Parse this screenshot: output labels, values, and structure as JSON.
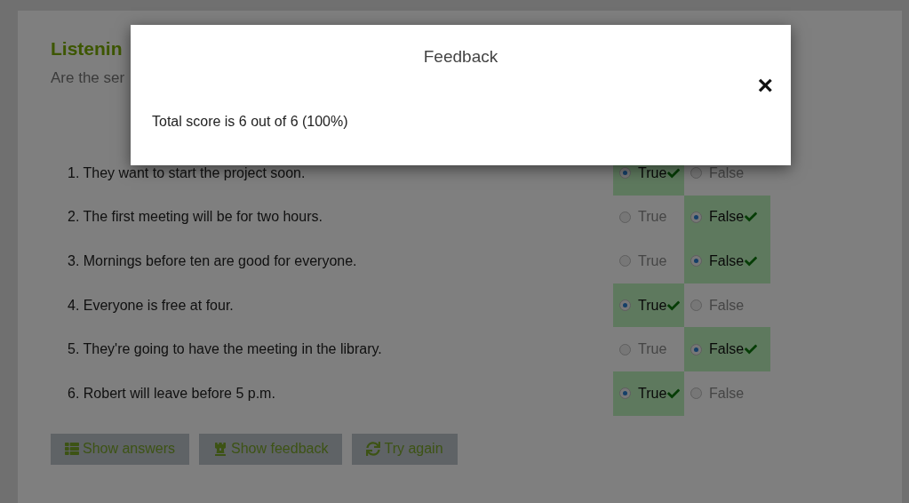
{
  "page": {
    "title": "Listenin",
    "instructions": "Are the ser"
  },
  "modal": {
    "title": "Feedback",
    "close": "×",
    "message": "Total score is 6 out of 6 (100%)"
  },
  "questions": [
    {
      "text": "1. They want to start the project soon.",
      "options": [
        {
          "label": "True",
          "selected": true,
          "correct": true
        },
        {
          "label": "False",
          "selected": false,
          "correct": false
        }
      ]
    },
    {
      "text": "2. The first meeting will be for two hours.",
      "options": [
        {
          "label": "True",
          "selected": false,
          "correct": false
        },
        {
          "label": "False",
          "selected": true,
          "correct": true
        }
      ]
    },
    {
      "text": "3. Mornings before ten are good for everyone.",
      "options": [
        {
          "label": "True",
          "selected": false,
          "correct": false
        },
        {
          "label": "False",
          "selected": true,
          "correct": true
        }
      ]
    },
    {
      "text": "4. Everyone is free at four.",
      "options": [
        {
          "label": "True",
          "selected": true,
          "correct": true
        },
        {
          "label": "False",
          "selected": false,
          "correct": false
        }
      ]
    },
    {
      "text": "5. They're going to have the meeting in the library.",
      "options": [
        {
          "label": "True",
          "selected": false,
          "correct": false
        },
        {
          "label": "False",
          "selected": true,
          "correct": true
        }
      ]
    },
    {
      "text": "6. Robert will leave before 5 p.m.",
      "options": [
        {
          "label": "True",
          "selected": true,
          "correct": true
        },
        {
          "label": "False",
          "selected": false,
          "correct": false
        }
      ]
    }
  ],
  "buttons": [
    {
      "label": "Show answers",
      "kind": "answers"
    },
    {
      "label": "Show feedback",
      "kind": "feedback"
    },
    {
      "label": "Try again",
      "kind": "retry"
    }
  ]
}
